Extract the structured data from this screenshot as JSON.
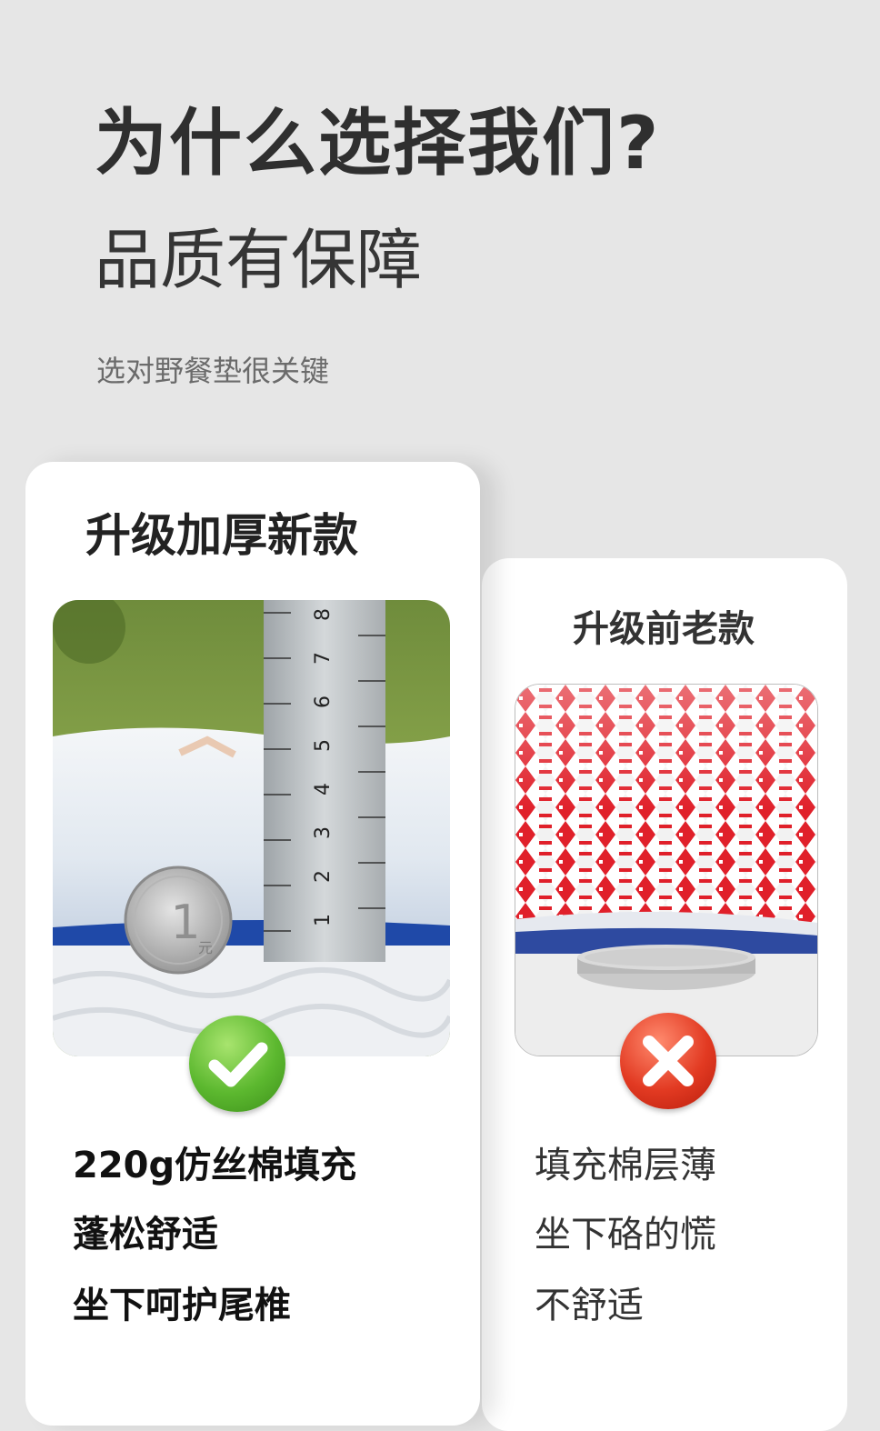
{
  "header": {
    "headline": "为什么选择我们?",
    "subheadline": "品质有保障",
    "tagline": "选对野餐垫很关键"
  },
  "new_card": {
    "title": "升级加厚新款",
    "photo_icon": "ruler-coin-photo",
    "badge_icon": "check-icon",
    "features": [
      "220g仿丝棉填充",
      "蓬松舒适",
      "坐下呵护尾椎"
    ],
    "ruler_numbers": [
      "1",
      "2",
      "3",
      "4",
      "5",
      "6",
      "7",
      "8"
    ],
    "coin_text": "1",
    "coin_unit": "元"
  },
  "old_card": {
    "title": "升级前老款",
    "photo_icon": "red-pattern-coin-photo",
    "badge_icon": "cross-icon",
    "features": [
      "填充棉层薄",
      "坐下硌的慌",
      "不舒适"
    ]
  },
  "colors": {
    "background": "#e6e6e6",
    "check": "#5cb82f",
    "cross": "#e23a22",
    "pattern_red": "#e0202a"
  }
}
